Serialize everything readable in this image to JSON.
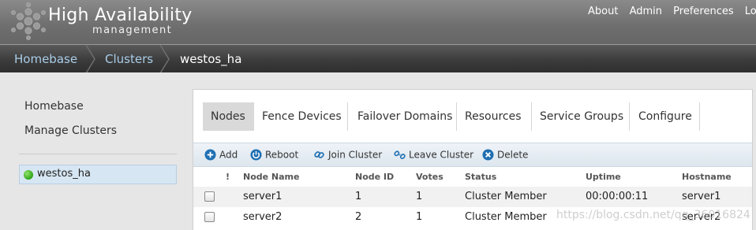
{
  "header": {
    "title": "High Availability",
    "subtitle": "management",
    "nav": [
      "About",
      "Admin",
      "Preferences",
      "Logo"
    ]
  },
  "breadcrumb": {
    "items": [
      "Homebase",
      "Clusters"
    ],
    "current": "westos_ha"
  },
  "sidebar": {
    "links": [
      "Homebase",
      "Manage Clusters"
    ],
    "clusters": [
      {
        "name": "westos_ha",
        "status_color": "#2fa416"
      }
    ]
  },
  "tabs": [
    "Nodes",
    "Fence Devices",
    "Failover Domains",
    "Resources",
    "Service Groups",
    "Configure"
  ],
  "active_tab": "Nodes",
  "toolbar": {
    "add": "Add",
    "reboot": "Reboot",
    "join": "Join Cluster",
    "leave": "Leave Cluster",
    "delete": "Delete"
  },
  "table": {
    "columns": [
      "!",
      "Node Name",
      "Node ID",
      "Votes",
      "Status",
      "Uptime",
      "Hostname"
    ],
    "rows": [
      {
        "name": "server1",
        "id": "1",
        "votes": "1",
        "status": "Cluster Member",
        "uptime": "00:00:00:11",
        "hostname": "server1"
      },
      {
        "name": "server2",
        "id": "2",
        "votes": "1",
        "status": "Cluster Member",
        "uptime": "",
        "hostname": "server2"
      }
    ]
  },
  "watermark": "https://blog.csdn.net/qq_36016824",
  "colors": {
    "link": "#a9cde8",
    "accent": "#1f6fb2",
    "active_cluster_bg": "#d6e6f2"
  }
}
